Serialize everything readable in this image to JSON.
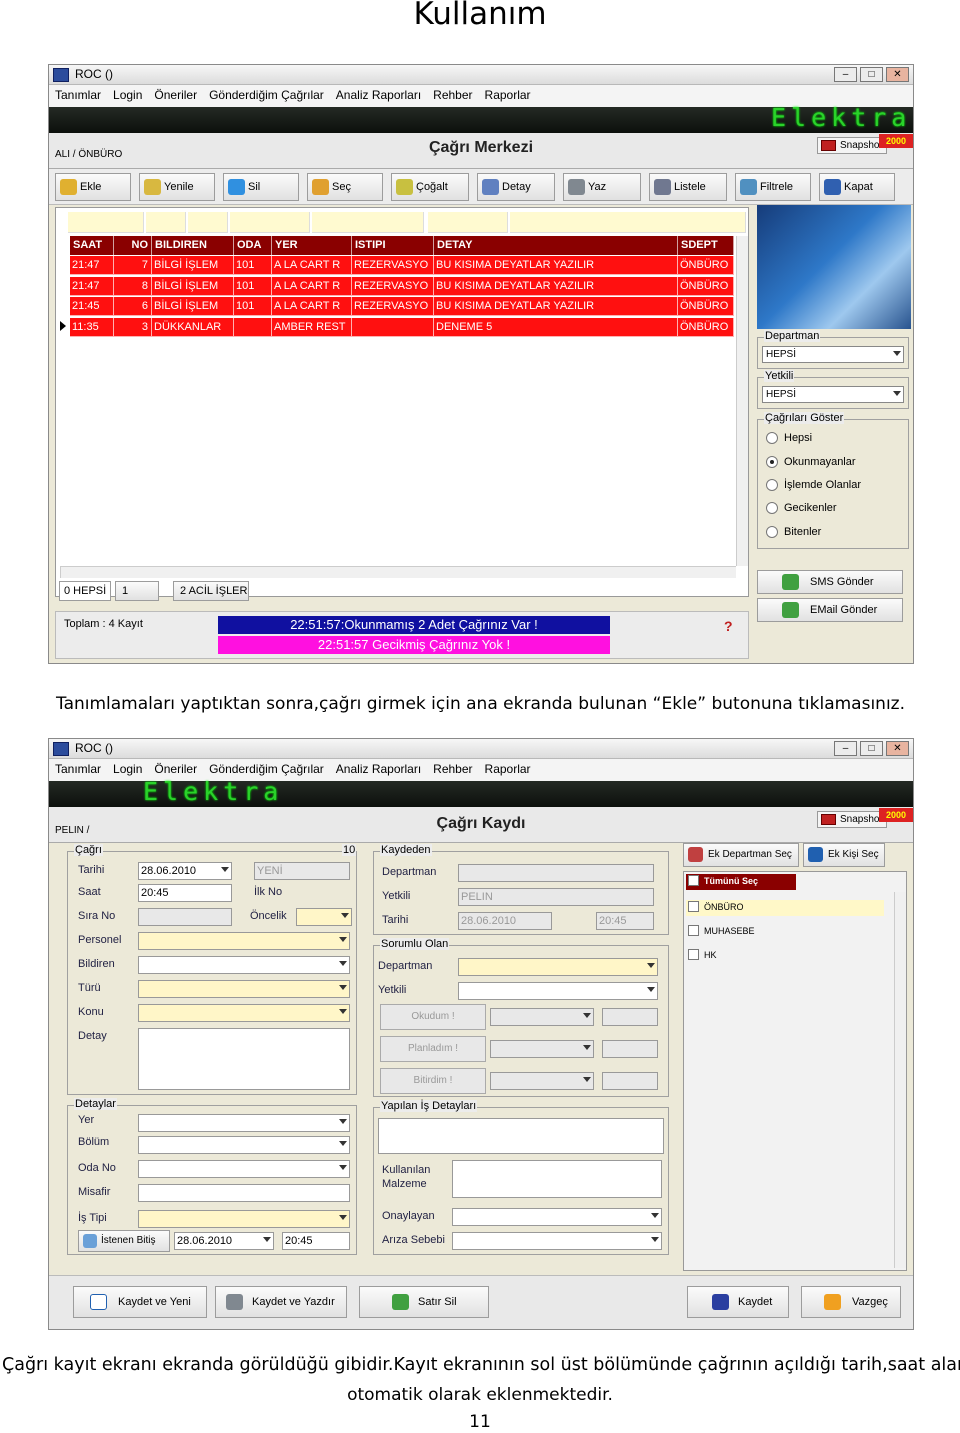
{
  "page": {
    "heading": "Kullanım",
    "caption1": "Tanımlamaları yaptıktan sonra,çağrı  girmek için ana ekranda bulunan “Ekle” butonuna tıklamasınız.",
    "caption2_line1": "Çağrı kayıt ekranı ekranda görüldüğü gibidir.Kayıt ekranının sol üst bölümünde çağrının açıldığı tarih,saat alanları",
    "caption2_line2": "otomatik olarak eklenmektedir.",
    "page_number": "11"
  },
  "app": {
    "title": "ROC ()",
    "banner": "Elektra",
    "y2k": "2000",
    "snapshot": "Snapshot",
    "menu": [
      "Tanımlar",
      "Login",
      "Öneriler",
      "Gönderdiğim Çağrılar",
      "Analiz Raporları",
      "Rehber",
      "Raporlar"
    ]
  },
  "s1": {
    "user": "ALI / ÖNBÜRO",
    "title": "Çağrı Merkezi",
    "toolbar": [
      "Ekle",
      "Yenile",
      "Sil",
      "Seç",
      "Çoğalt",
      "Detay",
      "Yaz",
      "Listele",
      "Filtrele",
      "Kapat"
    ],
    "columns": [
      "SAAT",
      "NO",
      "BILDIREN",
      "ODA",
      "YER",
      "ISTIPI",
      "DETAY",
      "SDEPT"
    ],
    "rows": [
      [
        "21:47",
        "7",
        "BİLGİ İŞLEM",
        "101",
        "A LA CART R",
        "REZERVASYO",
        "BU KISIMA DEYATLAR YAZILIR",
        "ÖNBÜRO"
      ],
      [
        "21:47",
        "8",
        "BİLGİ İŞLEM",
        "101",
        "A LA CART R",
        "REZERVASYO",
        "BU KISIMA DEYATLAR YAZILIR",
        "ÖNBÜRO"
      ],
      [
        "21:45",
        "6",
        "BİLGİ İŞLEM",
        "101",
        "A LA CART R",
        "REZERVASYO",
        "BU KISIMA DEYATLAR YAZILIR",
        "ÖNBÜRO"
      ],
      [
        "11:35",
        "3",
        "DÜKKANLAR",
        "",
        "AMBER REST",
        "",
        "DENEME 5",
        "ÖNBÜRO"
      ]
    ],
    "tabs": [
      "0 HEPSİ",
      "1",
      "2 ACİL İŞLER"
    ],
    "total": "Toplam : 4 Kayıt",
    "msg1": "22:51:57:Okunmamış 2 Adet Çağrınız Var !",
    "msg2": "22:51:57 Gecikmiş Çağrınız Yok !",
    "dept_label": "Departman",
    "dept_value": "HEPSİ",
    "yetkili_label": "Yetkili",
    "yetkili_value": "HEPSİ",
    "show_label": "Çağrıları Göster",
    "radios": [
      "Hepsi",
      "Okunmayanlar",
      "İşlemde Olanlar",
      "Gecikenler",
      "Bitenler"
    ],
    "radio_selected": "Okunmayanlar",
    "sms": "SMS Gönder",
    "email": "EMail Gönder",
    "help": "?"
  },
  "s2": {
    "user": "PELIN /",
    "title": "Çağrı Kaydı",
    "cagri_label": "Çağrı",
    "count": "10",
    "tarih_label": "Tarihi",
    "tarih": "28.06.2010",
    "yeni": "YENİ",
    "saat_label": "Saat",
    "saat": "20:45",
    "ilkno": "İlk No",
    "sira": "Sıra No",
    "oncelik": "Öncelik",
    "personel": "Personel",
    "bildiren": "Bildiren",
    "turu": "Türü",
    "konu": "Konu",
    "detay": "Detay",
    "detaylar_label": "Detaylar",
    "yer": "Yer",
    "bolum": "Bölüm",
    "odano": "Oda No",
    "misafir": "Misafir",
    "istipi": "İş Tipi",
    "istenen": "İstenen Bitiş",
    "ist_tarih": "28.06.2010",
    "ist_saat": "20:45",
    "kaydeden_label": "Kaydeden",
    "k_dept": "Departman",
    "k_yetkili": "Yetkili",
    "k_yetkili_val": "PELIN",
    "k_tarih": "Tarihi",
    "k_tarih_val": "28.06.2010",
    "k_saat_val": "20:45",
    "sorumlu_label": "Sorumlu Olan",
    "s_dept": "Departman",
    "s_yetkili": "Yetkili",
    "okudum": "Okudum !",
    "planladim": "Planladım !",
    "bitirdim": "Bitirdim !",
    "yapilan_label": "Yapılan İş Detayları",
    "kullanilan": "Kullanılan",
    "malzeme": "Malzeme",
    "onaylayan": "Onaylayan",
    "ariza": "Arıza Sebebi",
    "ek_dept": "Ek Departman Seç",
    "ek_kisi": "Ek Kişi Seç",
    "tumunu": "Tümünü Seç",
    "depts": [
      "ÖNBÜRO",
      "MUHASEBE",
      "HK"
    ],
    "footer": [
      "Kaydet ve Yeni",
      "Kaydet ve Yazdır",
      "Satır Sil",
      "Kaydet",
      "Vazgeç"
    ]
  },
  "colors": {
    "accent_red": "#ff1010",
    "header_dark_red": "#8a0000",
    "msg_blue": "#1010a0",
    "msg_pink": "#ff10e0",
    "field_yellow": "#fff6c8",
    "banner_green": "#2bd22b"
  }
}
